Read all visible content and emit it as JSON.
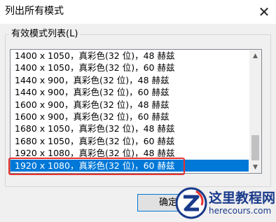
{
  "dialog": {
    "title": "列出所有模式",
    "close_glyph": "✕",
    "group_label": "有效模式列表(L)",
    "list": {
      "items": [
        "1400 x 1050，真彩色(32 位)，48 赫兹",
        "1400 x 1050，真彩色(32 位)，60 赫兹",
        "1440 x 900，真彩色(32 位)，48 赫兹",
        "1440 x 900，真彩色(32 位)，60 赫兹",
        "1600 x 900，真彩色(32 位)，48 赫兹",
        "1600 x 900，真彩色(32 位)，60 赫兹",
        "1680 x 1050，真彩色(32 位)，48 赫兹",
        "1680 x 1050，真彩色(32 位)，60 赫兹",
        "1920 x 1080，真彩色(32 位)，48 赫兹",
        "1920 x 1080，真彩色(32 位)，60 赫兹"
      ],
      "selected_index": 9,
      "selection_color": "#0078d7",
      "scroll_up_glyph": "▲",
      "scroll_down_glyph": "▼"
    },
    "ok_label": "确定",
    "highlight_color": "#e8322e"
  },
  "watermark": {
    "brand": "这里教程网",
    "url": "herecours.com",
    "icon": "z-logo-icon"
  }
}
